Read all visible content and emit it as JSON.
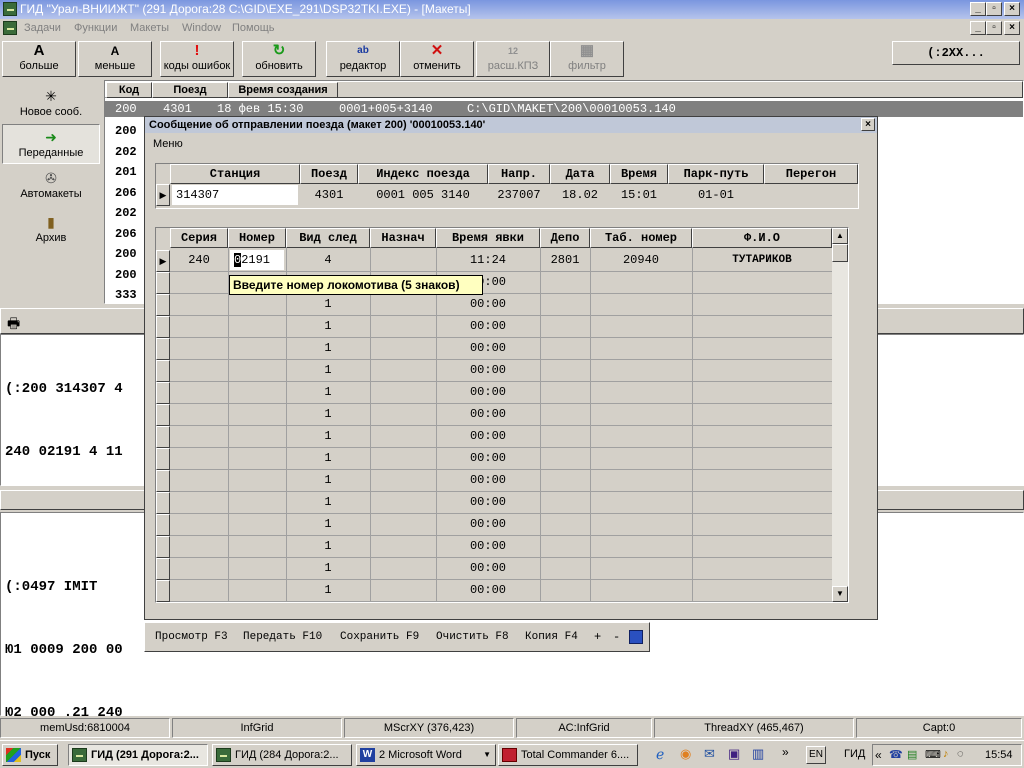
{
  "window": {
    "title": "ГИД \"Урал-ВНИИЖТ\" (291 Дорога:28 C:\\GID\\EXE_291\\DSP32TKI.EXE) - [Макеты]"
  },
  "menu": [
    "Задачи",
    "Функции",
    "Макеты",
    "Window",
    "Помощь"
  ],
  "toolbar": {
    "buttons": [
      {
        "label": "больше",
        "icon": "A"
      },
      {
        "label": "меньше",
        "icon": "A"
      },
      {
        "label": "коды ошибок",
        "icon": "!"
      },
      {
        "label": "обновить",
        "icon": "↻"
      },
      {
        "label": "редактор",
        "icon": "ab"
      },
      {
        "label": "отменить",
        "icon": "✕"
      },
      {
        "label": "расш.КПЗ",
        "icon": "12"
      },
      {
        "label": "фильтр",
        "icon": "▦"
      }
    ],
    "right_field": "(:2XX..."
  },
  "left_panel": [
    {
      "label": "Новое сооб.",
      "icon": "✳"
    },
    {
      "label": "Переданные",
      "icon": "➜"
    },
    {
      "label": "Автомакеты",
      "icon": "✇"
    },
    {
      "label": "Архив",
      "icon": "▮"
    }
  ],
  "list": {
    "headers": [
      "Код",
      "Поезд",
      "Время создания"
    ],
    "selected_row": {
      "code": "200",
      "train": "4301",
      "time": "18 фев 15:30",
      "index": "0001+005+3140",
      "path": "C:\\GID\\MAKET\\200\\00010053.140"
    },
    "codes": [
      "200",
      "202",
      "201",
      "206",
      "202",
      "206",
      "200",
      "200",
      "333"
    ]
  },
  "middle_panel": {
    "lines": [
      "(:200 314307 4",
      "240 02191 4 11"
    ]
  },
  "bottom_panel": {
    "lines": [
      "(:0497 IMIT",
      "Ю1 0009 200 00",
      "Ю2 000 .21 240"
    ]
  },
  "dialog": {
    "title": "Сообщение об отправлении поезда (макет 200) '00010053.140'",
    "menu": "Меню",
    "top_table": {
      "headers": [
        "Станция",
        "Поезд",
        "Индекс поезда",
        "Напр.",
        "Дата",
        "Время",
        "Парк-путь",
        "Перегон"
      ],
      "row": [
        "314307",
        "4301",
        "0001 005 3140",
        "237007",
        "18.02",
        "15:01",
        "01-01",
        ""
      ]
    },
    "crew_table": {
      "headers": [
        "Серия",
        "Номер",
        "Вид след",
        "Назнач",
        "Время явки",
        "Депо",
        "Таб. номер",
        "Ф.И.О"
      ],
      "first_row": [
        "240",
        "02191",
        "4",
        "",
        "11:24",
        "2801",
        "20940",
        "ТУТАРИКОВ"
      ],
      "empty_row": {
        "vid": "1",
        "time": "00:00"
      }
    },
    "tooltip": "Введите номер локомотива (5 знаков)",
    "footer": [
      "Просмотр F3",
      "Передать F10",
      "Сохранить F9",
      "Очистить F8",
      "Копия F4",
      "+",
      "-"
    ]
  },
  "statusbar": [
    "memUsd:6810004",
    "InfGrid",
    "MScrXY (376,423)",
    "AC:InfGrid",
    "ThreadXY (465,467)",
    "Capt:0"
  ],
  "taskbar": {
    "start": "Пуск",
    "tasks": [
      "ГИД (291 Дорога:2...",
      "ГИД (284 Дорога:2...",
      "2 Microsoft Word",
      "Total Commander 6...."
    ],
    "lang": "EN",
    "gid": "ГИД",
    "clock": "15:54"
  },
  "colors": {
    "title_gradient_start": "#7a96df",
    "tooltip_bg": "#ffffc0",
    "selected_row_bg": "#808080"
  }
}
